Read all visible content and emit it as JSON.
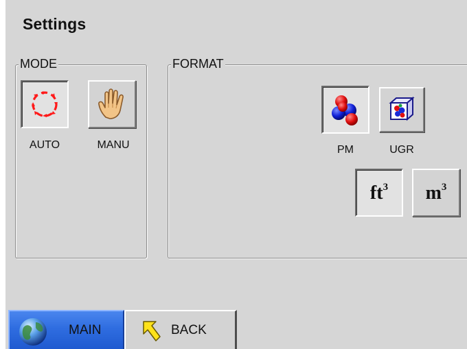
{
  "header": {
    "title": "Settings"
  },
  "mode": {
    "legend": "MODE",
    "selected": "auto",
    "options": [
      {
        "id": "auto",
        "label": "AUTO",
        "icon": "auto-cycle-icon",
        "selected": true
      },
      {
        "id": "manu",
        "label": "MANU",
        "icon": "hand-icon",
        "selected": false
      }
    ]
  },
  "format": {
    "legend": "FORMAT",
    "type_options": [
      {
        "id": "pm",
        "label": "PM",
        "icon": "particles-icon",
        "selected": true
      },
      {
        "id": "ugr",
        "label": "UGR",
        "icon": "particle-cube-icon",
        "selected": false
      }
    ],
    "unit_options": [
      {
        "id": "ft3",
        "base": "ft",
        "exponent": "3",
        "selected": true
      },
      {
        "id": "m3",
        "base": "m",
        "exponent": "3",
        "selected": false
      }
    ]
  },
  "tabs": {
    "main_label": "MAIN",
    "main_icon": "globe-icon",
    "back_label": "BACK",
    "back_icon": "back-arrow-icon"
  },
  "colors": {
    "background": "#d6d6d6",
    "main_tab": "#2f6de0",
    "auto_icon": "#ff0000"
  }
}
